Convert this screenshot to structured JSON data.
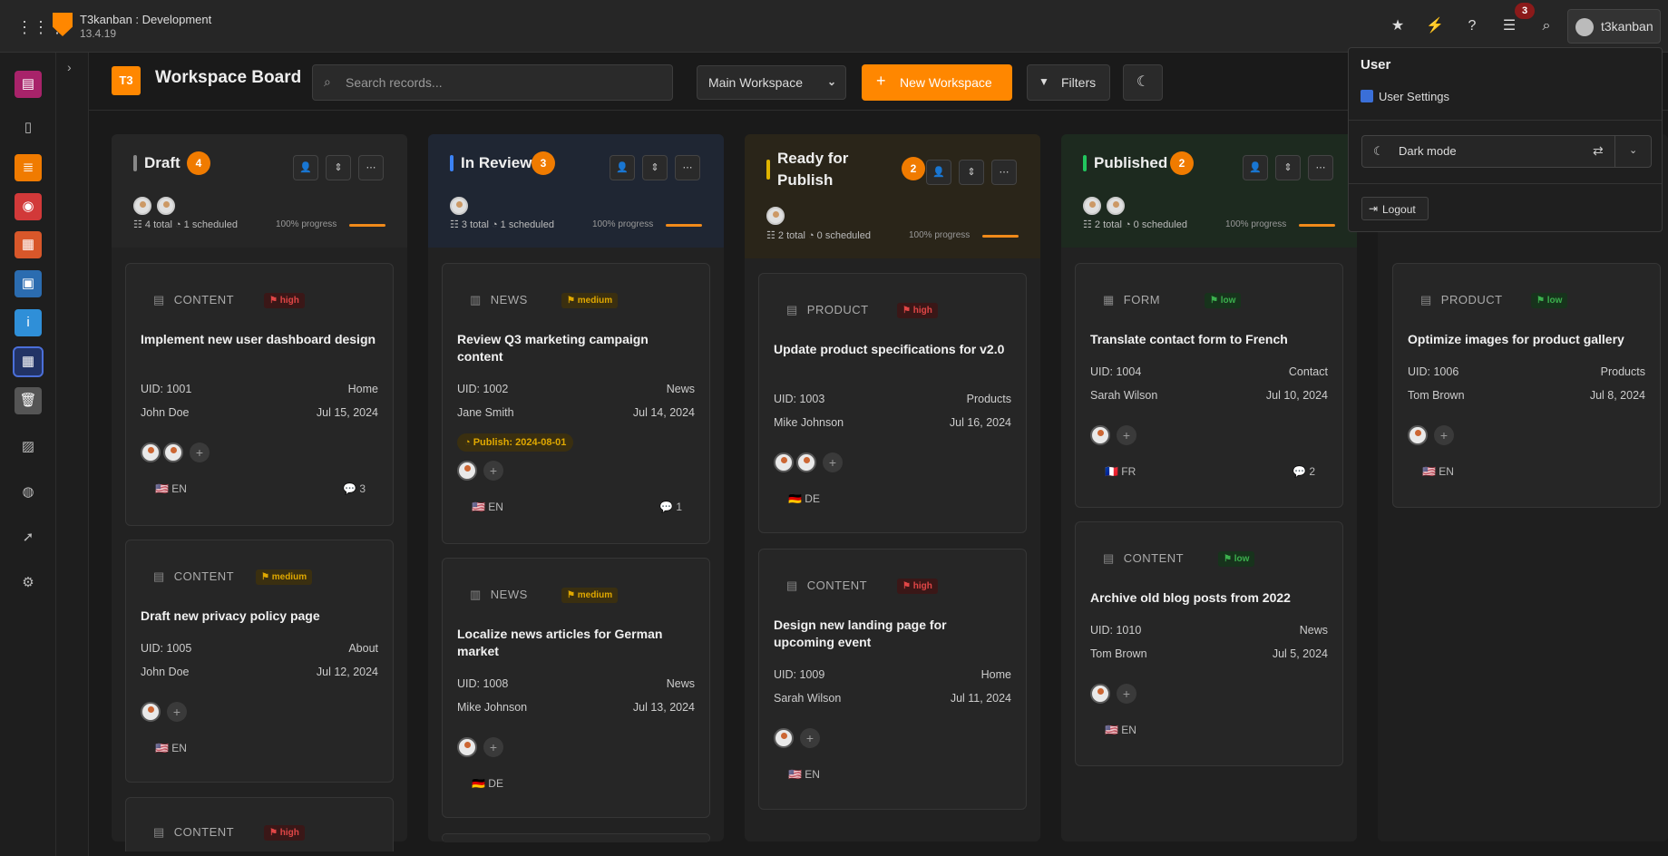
{
  "topbar": {
    "app_title": "T3kanban : Development",
    "app_version": "13.4.19",
    "notification_count": "3",
    "user_name": "t3kanban"
  },
  "header": {
    "board_logo": "T3",
    "board_title": "Workspace Board",
    "search_placeholder": "Search records...",
    "workspace_selected": "Main Workspace",
    "new_workspace_label": "New Workspace",
    "filters_label": "Filters"
  },
  "user_menu": {
    "title": "User",
    "settings_label": "User Settings",
    "dark_mode_label": "Dark mode",
    "logout_label": "Logout"
  },
  "colors": {
    "accent": "#ff8700",
    "draft": "#888888",
    "in_review": "#3b82f6",
    "ready": "#e0b400",
    "published": "#22c55e"
  },
  "columns": [
    {
      "title": "Draft",
      "count": "4",
      "total": "4 total",
      "scheduled": "1 scheduled",
      "progress": "100% progress",
      "cards": [
        {
          "type": "CONTENT",
          "priority": "high",
          "title": "Implement new user dashboard design",
          "uid": "UID: 1001",
          "page": "Home",
          "author": "John Doe",
          "date": "Jul 15, 2024",
          "lang": "🇺🇸 EN",
          "comments": "3"
        },
        {
          "type": "CONTENT",
          "priority": "medium",
          "title": "Draft new privacy policy page",
          "uid": "UID: 1005",
          "page": "About",
          "author": "John Doe",
          "date": "Jul 12, 2024",
          "lang": "🇺🇸 EN"
        },
        {
          "type": "CONTENT",
          "priority": "high"
        }
      ]
    },
    {
      "title": "In Review",
      "count": "3",
      "total": "3 total",
      "scheduled": "1 scheduled",
      "progress": "100% progress",
      "cards": [
        {
          "type": "NEWS",
          "priority": "medium",
          "title": "Review Q3 marketing campaign content",
          "uid": "UID: 1002",
          "page": "News",
          "author": "Jane Smith",
          "date": "Jul 14, 2024",
          "publish": "Publish: 2024-08-01",
          "lang": "🇺🇸 EN",
          "comments": "1"
        },
        {
          "type": "NEWS",
          "priority": "medium",
          "title": "Localize news articles for German market",
          "uid": "UID: 1008",
          "page": "News",
          "author": "Mike Johnson",
          "date": "Jul 13, 2024",
          "lang": "🇩🇪 DE"
        }
      ]
    },
    {
      "title_line1": "Ready for",
      "title_line2": "Publish",
      "count": "2",
      "total": "2 total",
      "scheduled": "0 scheduled",
      "progress": "100% progress",
      "cards": [
        {
          "type": "PRODUCT",
          "priority": "high",
          "title": "Update product specifications for v2.0",
          "uid": "UID: 1003",
          "page": "Products",
          "author": "Mike Johnson",
          "date": "Jul 16, 2024",
          "lang": "🇩🇪 DE"
        },
        {
          "type": "CONTENT",
          "priority": "high",
          "title": "Design new landing page for upcoming event",
          "uid": "UID: 1009",
          "page": "Home",
          "author": "Sarah Wilson",
          "date": "Jul 11, 2024",
          "lang": "🇺🇸 EN"
        }
      ]
    },
    {
      "title": "Published",
      "count": "2",
      "total": "2 total",
      "scheduled": "0 scheduled",
      "progress": "100% progress",
      "cards": [
        {
          "type": "FORM",
          "priority": "low",
          "title": "Translate contact form to French",
          "uid": "UID: 1004",
          "page": "Contact",
          "author": "Sarah Wilson",
          "date": "Jul 10, 2024",
          "lang": "🇫🇷 FR",
          "comments": "2"
        },
        {
          "type": "CONTENT",
          "priority": "low",
          "title": "Archive old blog posts from 2022",
          "uid": "UID: 1010",
          "page": "News",
          "author": "Tom Brown",
          "date": "Jul 5, 2024",
          "lang": "🇺🇸 EN"
        }
      ]
    },
    {
      "cards": [
        {
          "type": "PRODUCT",
          "priority": "low",
          "title": "Optimize images for product gallery",
          "uid": "UID: 1006",
          "page": "Products",
          "author": "Tom Brown",
          "date": "Jul 8, 2024",
          "lang": "🇺🇸 EN"
        }
      ]
    }
  ]
}
